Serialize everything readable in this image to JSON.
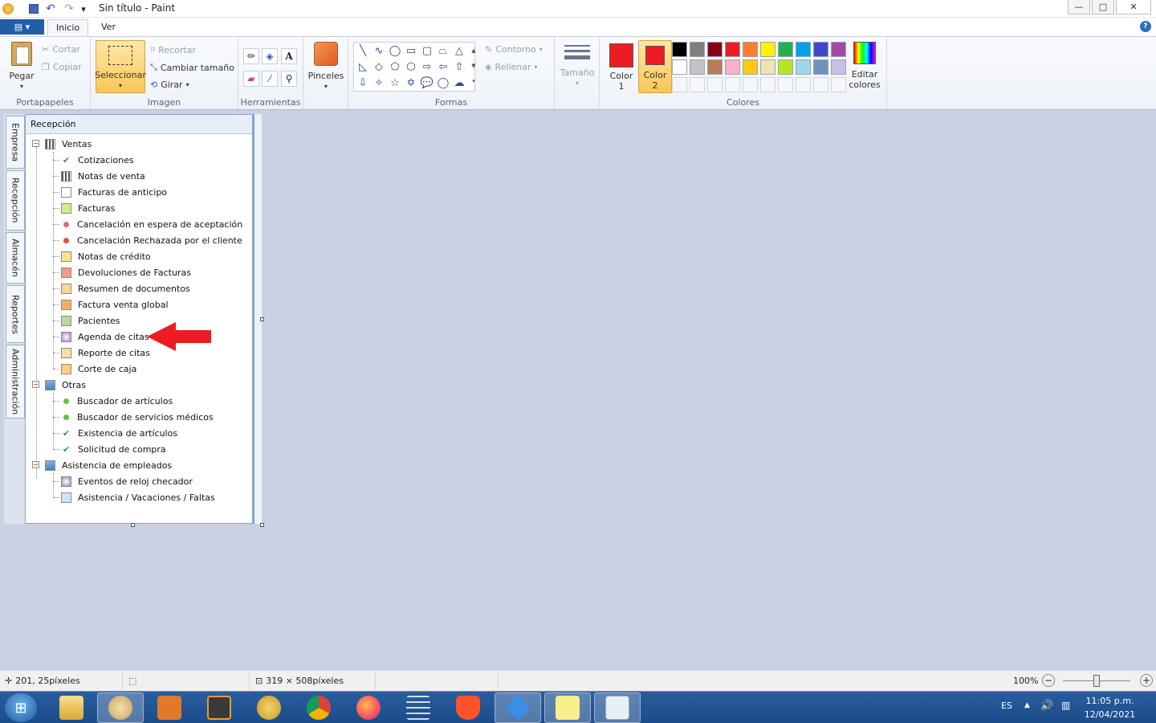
{
  "window": {
    "title": "Sin título - Paint",
    "controls": {
      "minimize": "—",
      "maximize": "□",
      "close": "✕"
    }
  },
  "ribbon_tabs": {
    "file_label": "▤ ▾",
    "tabs": [
      "Inicio",
      "Ver"
    ],
    "active": "Inicio",
    "help": "?"
  },
  "ribbon": {
    "clipboard": {
      "label": "Portapapeles",
      "paste": "Pegar",
      "cut": "Cortar",
      "copy": "Copiar"
    },
    "image": {
      "label": "Imagen",
      "select": "Seleccionar",
      "crop": "Recortar",
      "resize": "Cambiar tamaño",
      "rotate": "Girar"
    },
    "tools": {
      "label": "Herramientas"
    },
    "brushes": {
      "label": "Pinceles"
    },
    "shapes": {
      "label": "Formas",
      "outline": "Contorno",
      "fill": "Rellenar"
    },
    "size": {
      "label": "Tamaño"
    },
    "colors": {
      "label": "Colores",
      "color1": "Color 1",
      "color2": "Color 2",
      "edit": "Editar colores",
      "color1_value": "#ed1c24",
      "color2_value": "#ed1c24",
      "palette_row1": [
        "#000000",
        "#7f7f7f",
        "#880015",
        "#ed1c24",
        "#ff7f27",
        "#fff200",
        "#22b14c",
        "#00a2e8",
        "#3f48cc",
        "#a349a4"
      ],
      "palette_row2": [
        "#ffffff",
        "#c3c3c3",
        "#b97a57",
        "#ffaec9",
        "#ffc90e",
        "#efe4b0",
        "#b5e61d",
        "#99d9ea",
        "#7092be",
        "#c8bfe7"
      ]
    }
  },
  "image_content": {
    "vertical_tabs": [
      "Empresa",
      "Recepción",
      "Almacén",
      "Reportes",
      "Administración"
    ],
    "panel_title": "Recepción",
    "groups": [
      {
        "label": "Ventas",
        "items": [
          "Cotizaciones",
          "Notas de venta",
          "Facturas de anticipo",
          "Facturas",
          "Cancelación en espera de aceptación",
          "Cancelación Rechazada por el cliente",
          "Notas de crédito",
          "Devoluciones de Facturas",
          "Resumen de documentos",
          "Factura venta global",
          "Pacientes",
          "Agenda de citas",
          "Reporte de citas",
          "Corte de caja"
        ]
      },
      {
        "label": "Otras",
        "items": [
          "Buscador de artículos",
          "Buscador de servicios médicos",
          "Existencia de artículos",
          "Solicitud de compra"
        ]
      },
      {
        "label": "Asistencia de empleados",
        "items": [
          "Eventos de reloj checador",
          "Asistencia / Vacaciones / Faltas"
        ]
      }
    ],
    "arrow_color": "#ed1c24"
  },
  "statusbar": {
    "cursor_pos": "201, 25píxeles",
    "image_size": "319 × 508píxeles",
    "zoom": "100%"
  },
  "taskbar": {
    "language": "ES",
    "time": "11:05 p.m.",
    "date": "12/04/2021"
  }
}
